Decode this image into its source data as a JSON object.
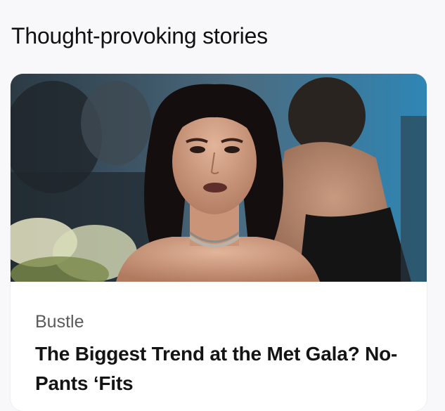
{
  "section": {
    "title": "Thought-provoking stories"
  },
  "card": {
    "image_alt": "Woman with dark wavy hair at the Met Gala",
    "source": "Bustle",
    "headline": "The Biggest Trend at the Met Gala? No-Pants ‘Fits"
  }
}
